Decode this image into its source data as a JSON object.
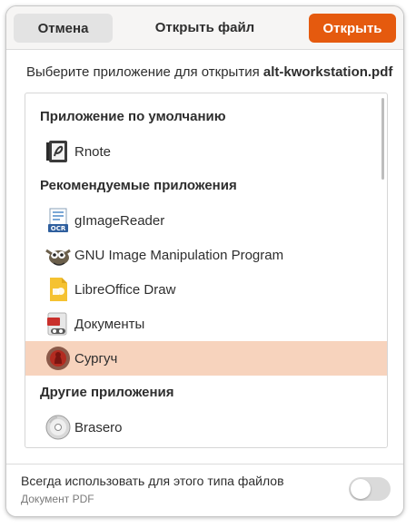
{
  "header": {
    "cancel_label": "Отмена",
    "title": "Открыть файл",
    "open_label": "Открыть"
  },
  "prompt": {
    "text": "Выберите приложение для открытия ",
    "filename": "alt-kworkstation.pdf"
  },
  "sections": {
    "default": "Приложение по умолчанию",
    "recommended": "Рекомендуемые приложения",
    "other": "Другие приложения"
  },
  "apps": {
    "rnote": {
      "label": "Rnote",
      "icon": "rnote-icon"
    },
    "gimagereader": {
      "label": "gImageReader",
      "icon": "ocr-icon"
    },
    "gimp": {
      "label": "GNU Image Manipulation Program",
      "icon": "gimp-icon"
    },
    "draw": {
      "label": "LibreOffice Draw",
      "icon": "libreoffice-draw-icon"
    },
    "documents": {
      "label": "Документы",
      "icon": "document-viewer-icon"
    },
    "surguch": {
      "label": "Сургуч",
      "icon": "seal-icon",
      "selected": true
    },
    "brasero": {
      "label": "Brasero",
      "icon": "disc-burner-icon"
    }
  },
  "footer": {
    "always_label": "Всегда использовать для этого типа файлов",
    "type_label": "Документ PDF",
    "toggle_on": false
  },
  "colors": {
    "accent": "#e55a0e",
    "selection": "#f7d3bd"
  }
}
